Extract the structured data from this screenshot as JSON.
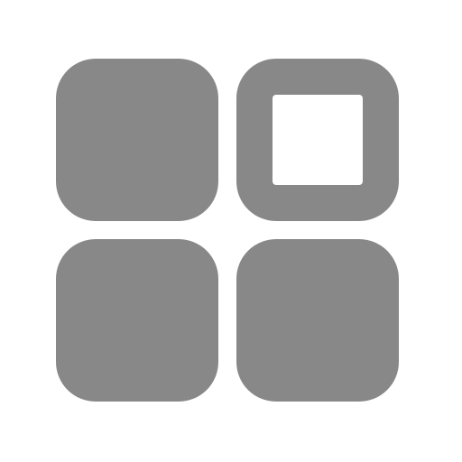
{
  "icon": {
    "name": "grid-apps-icon",
    "color": "#888888",
    "background": "#ffffff",
    "tiles": [
      {
        "name": "tile-top-left",
        "style": "filled"
      },
      {
        "name": "tile-top-right",
        "style": "outline"
      },
      {
        "name": "tile-bottom-left",
        "style": "filled"
      },
      {
        "name": "tile-bottom-right",
        "style": "filled"
      }
    ]
  }
}
